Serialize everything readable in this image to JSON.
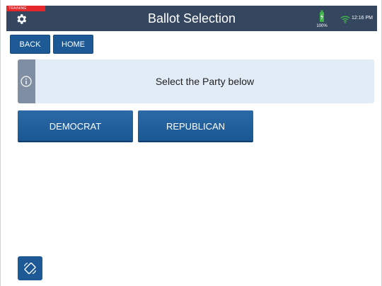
{
  "header": {
    "training_label": "TRAINING",
    "title": "Ballot Selection",
    "battery_percent": "100%",
    "time": "12:16 PM"
  },
  "nav": {
    "back_label": "BACK",
    "home_label": "HOME"
  },
  "banner": {
    "text": "Select the Party below"
  },
  "parties": [
    {
      "label": "DEMOCRAT"
    },
    {
      "label": "REPUBLICAN"
    }
  ],
  "icons": {
    "settings": "gear-icon",
    "battery": "battery-icon",
    "wifi": "wifi-icon",
    "info": "info-icon",
    "rotate": "rotate-screen-icon"
  },
  "colors": {
    "header_bg": "#35475f",
    "button_blue": "#1d5a95",
    "banner_bg": "#e1ecf6",
    "battery_green": "#3fb24a",
    "training_red": "#e5262b"
  }
}
